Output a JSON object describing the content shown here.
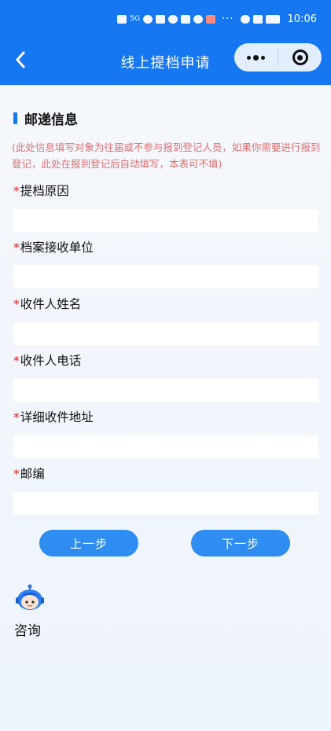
{
  "status_bar": {
    "time": "10:06",
    "signal": "5G",
    "more": "···"
  },
  "nav": {
    "title": "线上提档申请",
    "back_icon": "chevron-left-icon",
    "more_icon": "more-dots-icon",
    "close_icon": "target-circle-icon"
  },
  "section": {
    "title": "邮递信息",
    "notice": "(此处信息填写对象为往届或不参与报到登记人员，如果你需要进行报到登记，此处在报到登记后自动填写，本表可不填)"
  },
  "required_mark": "*",
  "fields": [
    {
      "label": "提档原因",
      "value": ""
    },
    {
      "label": "档案接收单位",
      "value": ""
    },
    {
      "label": "收件人姓名",
      "value": ""
    },
    {
      "label": "收件人电话",
      "value": ""
    },
    {
      "label": "详细收件地址",
      "value": ""
    },
    {
      "label": "邮编",
      "value": ""
    }
  ],
  "buttons": {
    "prev": "上一步",
    "next": "下一步"
  },
  "consult": {
    "label": "咨询",
    "icon": "assistant-avatar-icon"
  },
  "colors": {
    "primary": "#1677f2",
    "button": "#2f8cf1",
    "notice": "#e07070",
    "required": "#e02020"
  }
}
